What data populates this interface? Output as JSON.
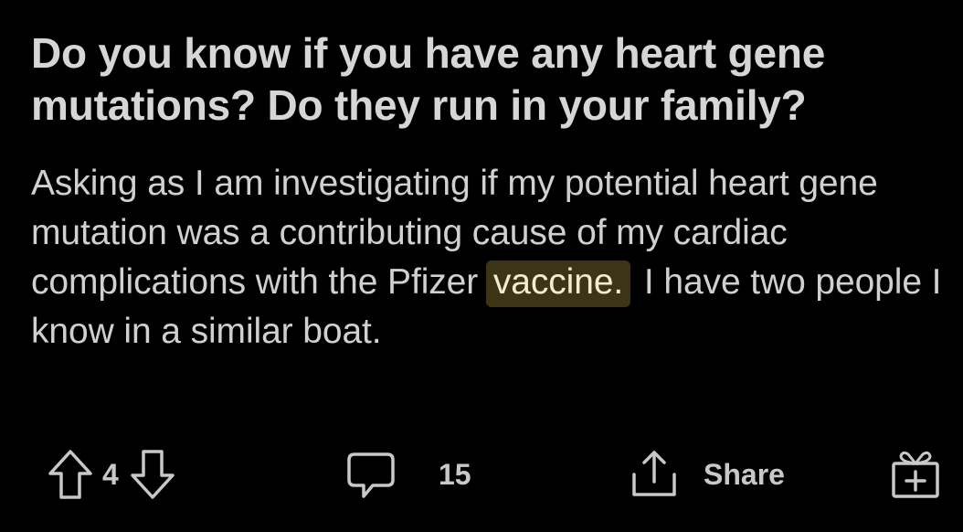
{
  "post": {
    "title": "Do you know if you have any heart gene mutations? Do they run in your family?",
    "body_before": "Asking as I am investigating if my potential heart gene mutation was a contributing cause of my cardiac complications with the Pfizer ",
    "body_highlight": "vaccine.",
    "body_after": " I have two people I know in a similar boat."
  },
  "actions": {
    "upvote_icon": "arrow-up-icon",
    "vote_count": "4",
    "downvote_icon": "arrow-down-icon",
    "comment_icon": "comment-bubble-icon",
    "comment_count": "15",
    "share_icon": "share-icon",
    "share_label": "Share",
    "award_icon": "gift-icon"
  },
  "colors": {
    "background": "#000000",
    "text": "#d4d4d4",
    "highlight_bg": "#3d3416",
    "highlight_text": "#f2eccc"
  }
}
